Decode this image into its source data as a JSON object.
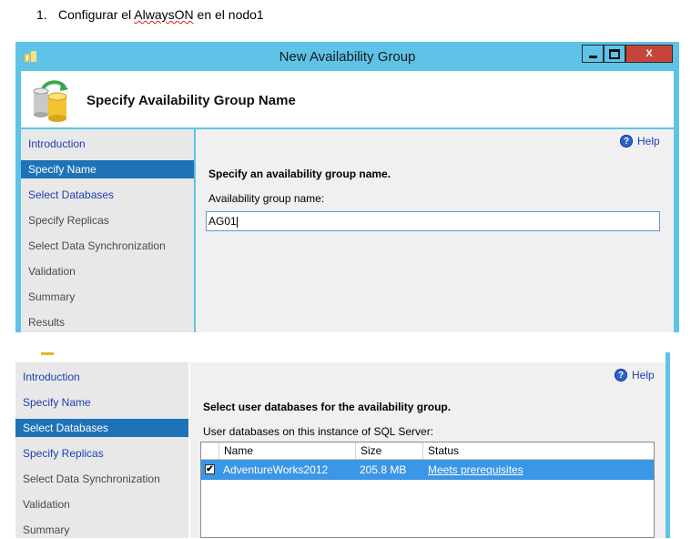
{
  "document": {
    "step_number": "1.",
    "heading_prefix": "Configurar el ",
    "heading_highlight": "AlwaysON",
    "heading_suffix": " en el nodo1"
  },
  "window1": {
    "title": "New Availability Group",
    "controls": {
      "close": "X"
    },
    "header_title": "Specify Availability Group Name",
    "nav": [
      {
        "label": "Introduction",
        "state": "link"
      },
      {
        "label": "Specify Name",
        "state": "selected"
      },
      {
        "label": "Select Databases",
        "state": "link"
      },
      {
        "label": "Specify Replicas",
        "state": "gray"
      },
      {
        "label": "Select Data Synchronization",
        "state": "gray"
      },
      {
        "label": "Validation",
        "state": "gray"
      },
      {
        "label": "Summary",
        "state": "gray"
      },
      {
        "label": "Results",
        "state": "gray"
      }
    ],
    "help": "Help",
    "instruction": "Specify an availability group name.",
    "field_label": "Availability group name:",
    "field_value": "AG01"
  },
  "window2": {
    "nav": [
      {
        "label": "Introduction",
        "state": "link"
      },
      {
        "label": "Specify Name",
        "state": "link"
      },
      {
        "label": "Select Databases",
        "state": "selected"
      },
      {
        "label": "Specify Replicas",
        "state": "link"
      },
      {
        "label": "Select Data Synchronization",
        "state": "gray"
      },
      {
        "label": "Validation",
        "state": "gray"
      },
      {
        "label": "Summary",
        "state": "gray"
      }
    ],
    "help": "Help",
    "instruction": "Select user databases for the availability group.",
    "grid_label": "User databases on this instance of SQL Server:",
    "columns": [
      "Name",
      "Size",
      "Status"
    ],
    "rows": [
      {
        "checked": true,
        "checkmark": "✔",
        "name": "AdventureWorks2012",
        "size": "205.8 MB",
        "status": "Meets prerequisites"
      }
    ]
  },
  "colors": {
    "titlebar": "#5ec3e6",
    "selected_nav": "#1e73b7",
    "selected_row": "#3c96e6",
    "link": "#1f3fb0",
    "close_button": "#c7443b"
  }
}
